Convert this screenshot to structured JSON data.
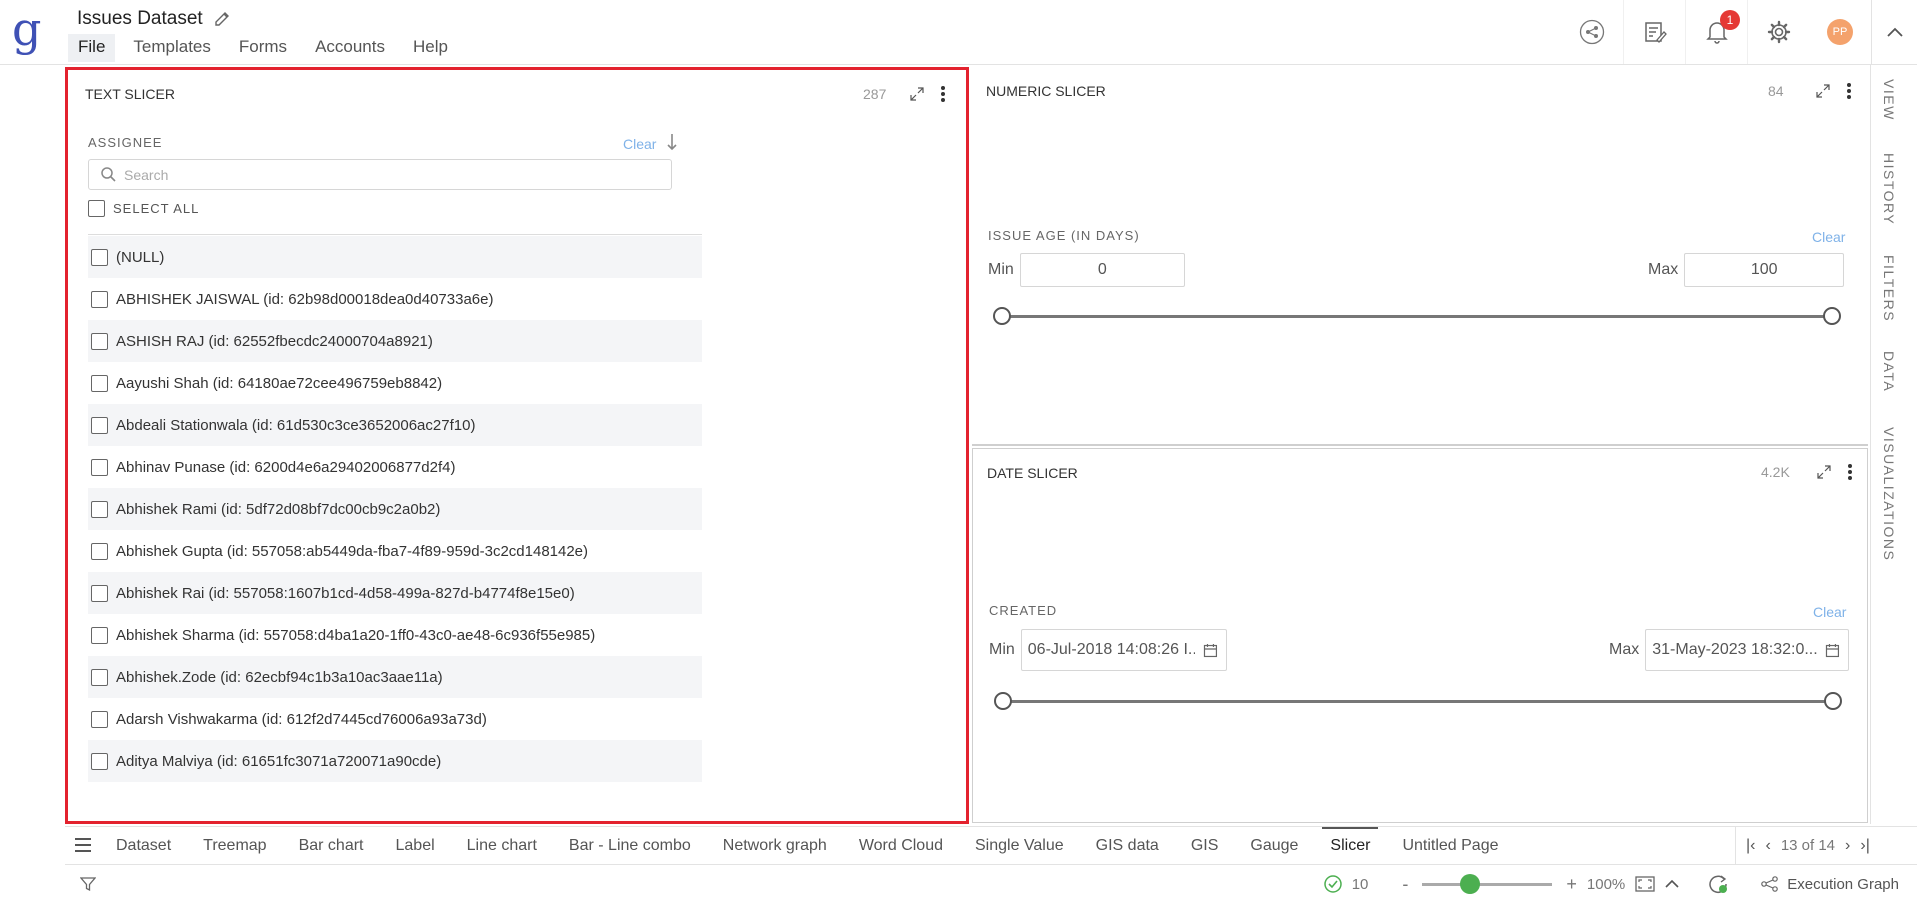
{
  "app": {
    "logo_letter": "g",
    "title": "Issues Dataset",
    "menus": [
      "File",
      "Templates",
      "Forms",
      "Accounts",
      "Help"
    ],
    "notification_count": "1",
    "avatar_initials": "PP"
  },
  "right_rail": [
    "VIEW",
    "HISTORY",
    "FILTERS",
    "DATA",
    "VISUALIZATIONS"
  ],
  "text_slicer": {
    "title": "TEXT SLICER",
    "count": "287",
    "field_label": "ASSIGNEE",
    "clear_label": "Clear",
    "search_placeholder": "Search",
    "select_all_label": "SELECT ALL",
    "items": [
      "(NULL)",
      "ABHISHEK JAISWAL (id: 62b98d00018dea0d40733a6e)",
      "ASHISH RAJ (id: 62552fbecdc24000704a8921)",
      "Aayushi Shah (id: 64180ae72cee496759eb8842)",
      "Abdeali Stationwala (id: 61d530c3ce3652006ac27f10)",
      "Abhinav Punase (id: 6200d4e6a29402006877d2f4)",
      "Abhishek Rami (id: 5df72d08bf7dc00cb9c2a0b2)",
      "Abhishek Gupta (id: 557058:ab5449da-fba7-4f89-959d-3c2cd148142e)",
      "Abhishek Rai (id: 557058:1607b1cd-4d58-499a-827d-b4774f8e15e0)",
      "Abhishek Sharma (id: 557058:d4ba1a20-1ff0-43c0-ae48-6c936f55e985)",
      "Abhishek.Zode (id: 62ecbf94c1b3a10ac3aae11a)",
      "Adarsh Vishwakarma (id: 612f2d7445cd76006a93a73d)",
      "Aditya Malviya (id: 61651fc3071a720071a90cde)"
    ]
  },
  "numeric_slicer": {
    "title": "NUMERIC SLICER",
    "count": "84",
    "field_label": "ISSUE AGE (IN DAYS)",
    "clear_label": "Clear",
    "min_label": "Min",
    "max_label": "Max",
    "min_value": "0",
    "max_value": "100"
  },
  "date_slicer": {
    "title": "DATE SLICER",
    "count": "4.2K",
    "field_label": "CREATED",
    "clear_label": "Clear",
    "min_label": "Min",
    "max_label": "Max",
    "min_value": "06-Jul-2018 14:08:26 I...",
    "max_value": "31-May-2023 18:32:0..."
  },
  "page_tabs": [
    "Dataset",
    "Treemap",
    "Bar chart",
    "Label",
    "Line chart",
    "Bar - Line combo",
    "Network graph",
    "Word Cloud",
    "Single Value",
    "GIS data",
    "GIS",
    "Gauge",
    "Slicer",
    "Untitled Page"
  ],
  "active_tab": "Slicer",
  "pager_text": "13 of 14",
  "status": {
    "check_count": "10",
    "zoom_minus": "-",
    "zoom_plus": "+",
    "zoom_level": "100%",
    "execution_graph_label": "Execution Graph"
  },
  "colors": {
    "selection_border": "#e3222e",
    "logo": "#3f51b5",
    "clear_link": "#7fb2e8",
    "zoom_knob": "#4caf50",
    "badge": "#e53935"
  }
}
